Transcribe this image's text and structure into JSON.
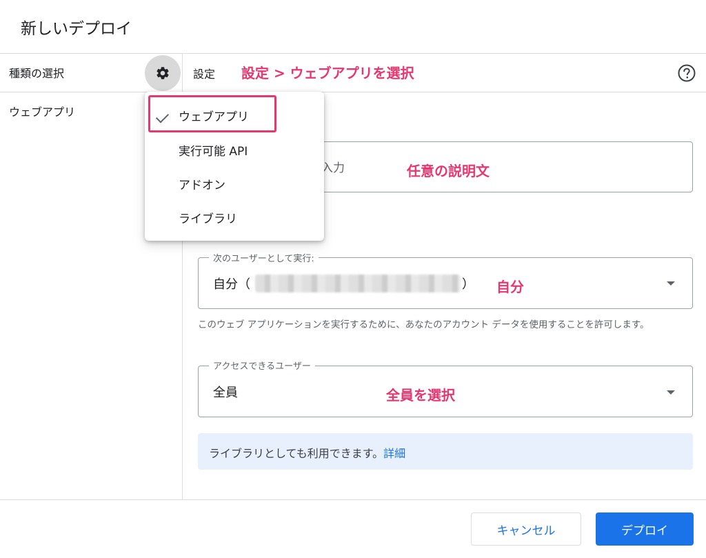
{
  "dialog": {
    "title": "新しいデプロイ"
  },
  "left_panel": {
    "header": "種類の選択",
    "gear_icon": "gear-icon",
    "selected_type": "ウェブアプリ"
  },
  "settings": {
    "label": "設定",
    "help_icon": "help-circle-icon"
  },
  "annotations": {
    "settings": "設定 > ウェブアプリを選択",
    "description": "任意の説明文",
    "execute_as": "自分",
    "access": "全員を選択"
  },
  "description_field": {
    "placeholder_visible": "入力"
  },
  "execute_as": {
    "legend": "次のユーザーとして実行:",
    "value_prefix": "自分（",
    "value_suffix": "）"
  },
  "helper_text": "このウェブ アプリケーションを実行するために、あなたのアカウント データを使用することを許可します。",
  "access": {
    "legend": "アクセスできるユーザー",
    "value": "全員"
  },
  "info": {
    "text": "ライブラリとしても利用できます。",
    "link": "詳細"
  },
  "footer": {
    "cancel": "キャンセル",
    "deploy": "デプロイ"
  },
  "type_menu": {
    "items": [
      {
        "label": "ウェブアプリ",
        "checked": true
      },
      {
        "label": "実行可能 API",
        "checked": false
      },
      {
        "label": "アドオン",
        "checked": false
      },
      {
        "label": "ライブラリ",
        "checked": false
      }
    ]
  },
  "colors": {
    "accent": "#1a73e8",
    "annotation": "#e8366f",
    "info_bg": "#e8f0fe"
  }
}
